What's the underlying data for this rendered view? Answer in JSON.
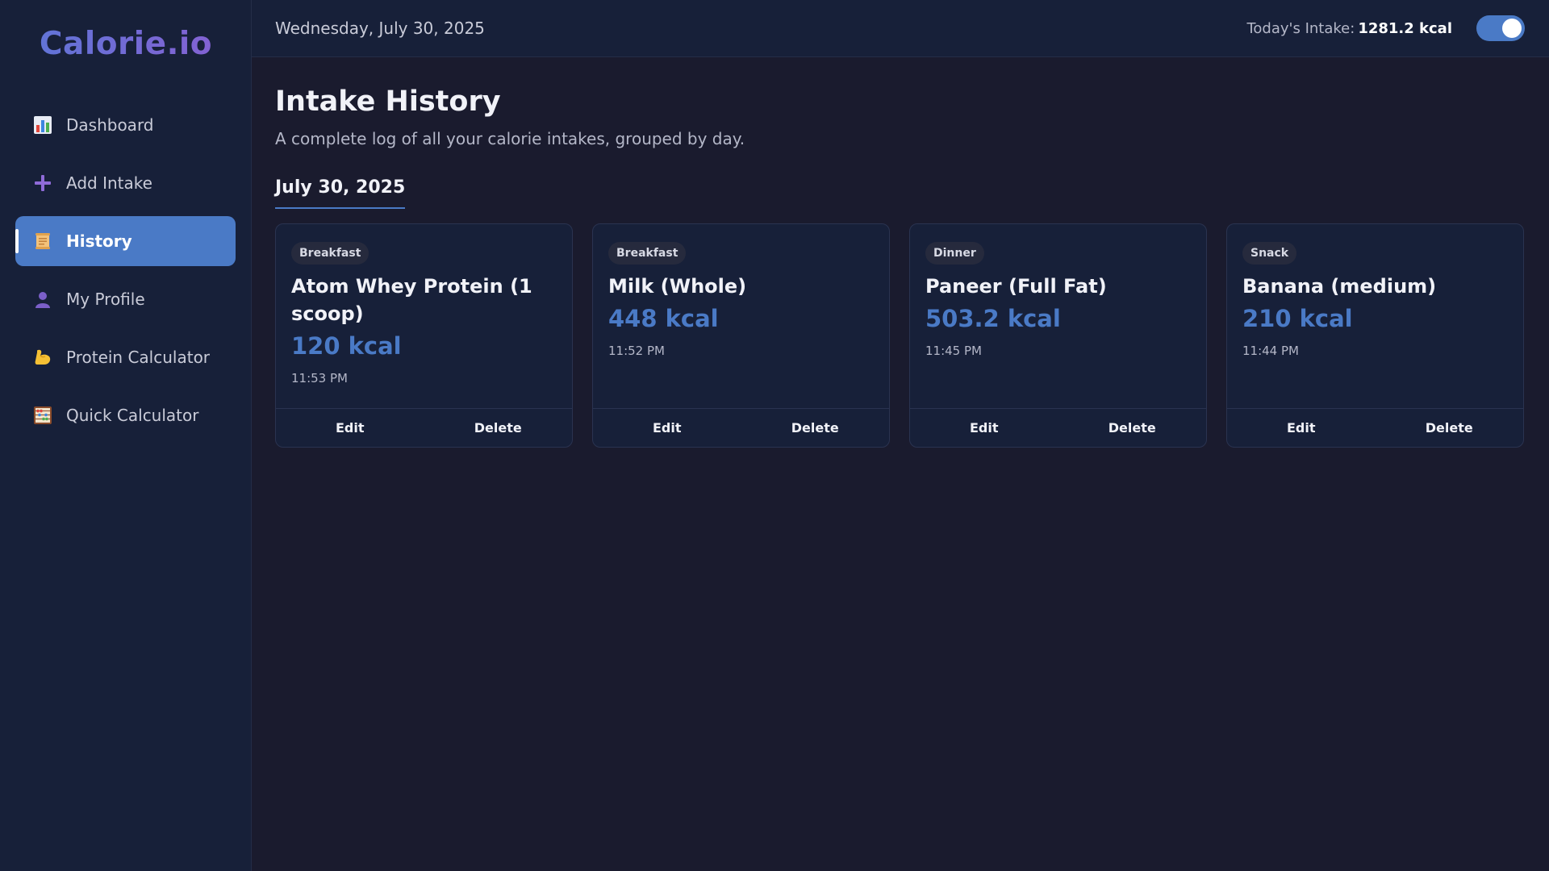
{
  "app": {
    "logo": "Calorie.io"
  },
  "sidebar": {
    "items": [
      {
        "label": "Dashboard",
        "icon": "bar-chart-icon",
        "active": false
      },
      {
        "label": "Add Intake",
        "icon": "plus-icon",
        "active": false
      },
      {
        "label": "History",
        "icon": "scroll-icon",
        "active": true
      },
      {
        "label": "My Profile",
        "icon": "user-icon",
        "active": false
      },
      {
        "label": "Protein Calculator",
        "icon": "flexed-biceps-icon",
        "active": false
      },
      {
        "label": "Quick Calculator",
        "icon": "abacus-icon",
        "active": false
      }
    ]
  },
  "topbar": {
    "date": "Wednesday, July 30, 2025",
    "intake_label": "Today's Intake:",
    "intake_value": "1281.2 kcal",
    "theme_toggle_on": true
  },
  "page": {
    "title": "Intake History",
    "subtitle": "A complete log of all your calorie intakes, grouped by day."
  },
  "days": [
    {
      "date": "July 30, 2025",
      "entries": [
        {
          "meal": "Breakfast",
          "name": "Atom Whey Protein (1 scoop)",
          "kcal": "120 kcal",
          "time": "11:53 PM",
          "edit": "Edit",
          "delete": "Delete"
        },
        {
          "meal": "Breakfast",
          "name": "Milk (Whole)",
          "kcal": "448 kcal",
          "time": "11:52 PM",
          "edit": "Edit",
          "delete": "Delete"
        },
        {
          "meal": "Dinner",
          "name": "Paneer (Full Fat)",
          "kcal": "503.2 kcal",
          "time": "11:45 PM",
          "edit": "Edit",
          "delete": "Delete"
        },
        {
          "meal": "Snack",
          "name": "Banana (medium)",
          "kcal": "210 kcal",
          "time": "11:44 PM",
          "edit": "Edit",
          "delete": "Delete"
        }
      ]
    }
  ],
  "colors": {
    "accent": "#4a7ac6",
    "background": "#1a1b2e",
    "panel": "#172039"
  }
}
